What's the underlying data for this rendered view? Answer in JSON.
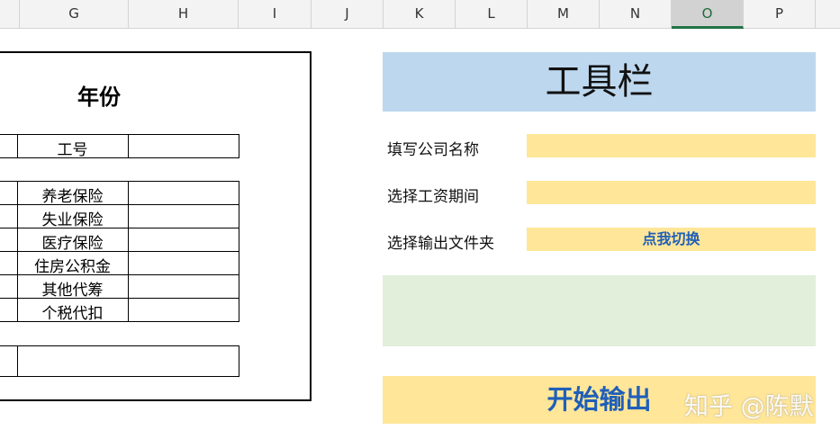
{
  "columns": [
    "G",
    "H",
    "I",
    "J",
    "K",
    "L",
    "M",
    "N",
    "O",
    "P"
  ],
  "selected_column": "O",
  "left_sheet": {
    "title": "年份",
    "employee_id_label": "工号",
    "insurance_items": [
      "养老保险",
      "失业保险",
      "医疗保险",
      "住房公积金",
      "其他代筹",
      "个税代扣"
    ]
  },
  "toolbar": {
    "title": "工具栏",
    "company_label": "填写公司名称",
    "company_value": "",
    "period_label": "选择工资期间",
    "period_value": "",
    "folder_label": "选择输出文件夹",
    "switch_button": "点我切换",
    "start_button": "开始输出"
  },
  "watermark": "知乎 @陈默",
  "colors": {
    "toolbar_header": "#bdd7ee",
    "input_fill": "#ffe699",
    "green_area": "#e2efda",
    "button_text": "#1f5fb8"
  }
}
